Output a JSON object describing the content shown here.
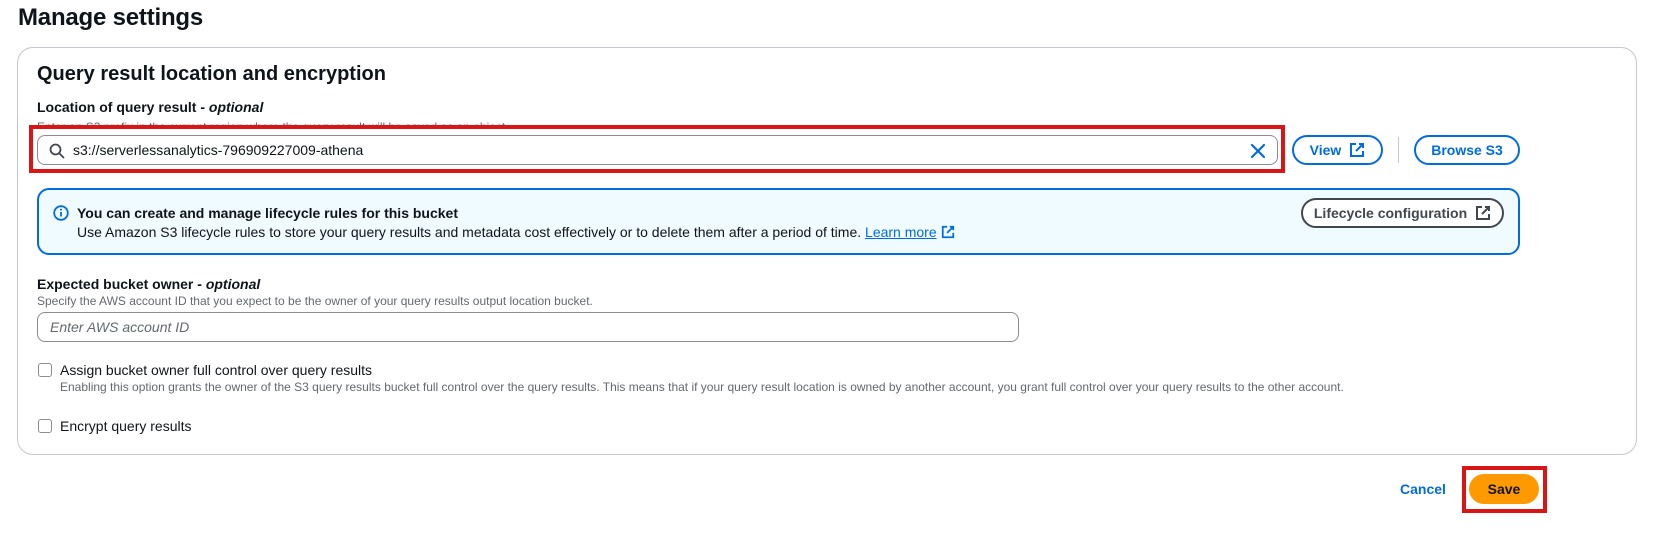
{
  "page": {
    "title": "Manage settings"
  },
  "section": {
    "title": "Query result location and encryption"
  },
  "location": {
    "label": "Location of query result - ",
    "label_optional": "optional",
    "description": "Enter an S3 prefix in the current region where the query result will be saved as an object.",
    "value": "s3://serverlessanalytics-796909227009-athena",
    "view_label": "View",
    "browse_label": "Browse S3"
  },
  "alert": {
    "title": "You can create and manage lifecycle rules for this bucket",
    "body": "Use Amazon S3 lifecycle rules to store your query results and metadata cost effectively or to delete them after a period of time.",
    "link": "Learn more",
    "button": "Lifecycle configuration"
  },
  "owner": {
    "label": "Expected bucket owner - ",
    "label_optional": "optional",
    "description": "Specify the AWS account ID that you expect to be the owner of your query results output location bucket.",
    "placeholder": "Enter AWS account ID"
  },
  "full_control": {
    "label": "Assign bucket owner full control over query results",
    "description": "Enabling this option grants the owner of the S3 query results bucket full control over the query results. This means that if your query result location is owned by another account, you grant full control over your query results to the other account."
  },
  "encrypt": {
    "label": "Encrypt query results"
  },
  "footer": {
    "cancel": "Cancel",
    "save": "Save"
  },
  "colors": {
    "primary": "#006ce0",
    "save": "#ff9900",
    "highlight": "#d91515",
    "alert_bg": "#f0fbff"
  },
  "icons": [
    "search-icon",
    "clear-icon",
    "external-link-icon",
    "info-icon"
  ]
}
